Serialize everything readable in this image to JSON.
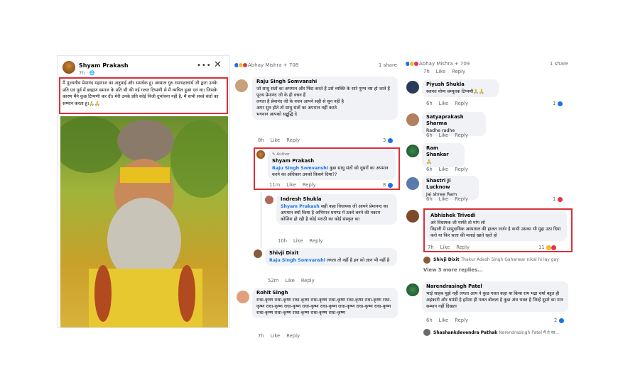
{
  "post": {
    "author": "Shyam Prakash",
    "time": "7h",
    "text": "मैं पूज्यनीय प्रेमानंद महाराज का अनुयाई और समर्थक हूं। अध्याल गुरु रामभद्राचार्य जी द्वारा उनके प्रति एवं पूर्व में ब्राह्मण समाज के प्रति भी की गई गलत टिप्पणी से मैं व्यथित हुआ एवं था। जिसके कारण मैंने कुछ टिप्पणी कर दी। मेरी उनके प्रति कोई निजी दुर्भावना नहीं है, मैं सभी सच्चे संतों का सम्मान करता हूं।🙏🙏",
    "more_icon": "three-dots-icon",
    "close_icon": "close-icon"
  },
  "panel2": {
    "reactors": "Abhay Mishra + 708",
    "shares": "1 share",
    "c1": {
      "name": "Raju Singh Somvanshi",
      "text": "जो साधु संतों का अपमान और निंदा करते हैं उसे व्यक्ति के सारे पुण्य नष्ट हो जाते हैं\nपूज्य प्रेमानंद जी के ही वचन हैं\nलगता है प्रेमानंद जी के वचन आपने सही से सुन नहीं है\nअगर सुन होते तो साधु संतों का अपमान नहीं करते\nभगवान आपको सद्बुद्धि दे",
      "time": "8h",
      "like": "Like",
      "reply": "Reply",
      "count": "3"
    },
    "c2": {
      "author_label": "Author",
      "name": "Shyam Prakash",
      "tag": "Raju Singh Somvanshi",
      "text": " कुछ साधु संतों को दूसरों का अपमान करने का अधिकार उनको किसने दिया??",
      "time": "11m",
      "like": "Like",
      "reply": "Reply",
      "count": "8"
    },
    "c3": {
      "name": "Indresh Shukla",
      "tag": "Shyam Prakash",
      "text": " सही कहा विधायक जी आपने प्रेमानन्द का अपमान क्यों किया है अभिमान घमण्ड में ठकरे बनने की नकाम कोशिश हो रही है कोई मराठी का कोई संस्कृत का",
      "time": "10h",
      "like": "Like",
      "reply": "Reply"
    },
    "c4": {
      "name": "Shivji Dixit",
      "tag": "Raju Singh Somvanshi",
      "text": " लगता तो नहीं है इन को ज्ञान भी नहीं है",
      "time": "52m",
      "like": "Like",
      "reply": "Reply"
    },
    "c5": {
      "name": "Rohit Singh",
      "text": "राधा-कृष्ण राधा-कृष्ण राधा-कृष्ण राधा-कृष्ण राधा-कृष्ण राधा-कृष्ण राधा-कृष्ण राधा-कृष्ण राधा-कृष्ण राधा-कृष्ण राधा-कृष्ण राधा-कृष्ण राधा-कृष्ण राधा-कृष्ण राधा-कृष्ण राधा-कृष्ण राधा-कृष्ण राधा-कृष्ण राधा-कृष्ण राधा-कृष्ण",
      "time": "7h",
      "like": "Like",
      "reply": "Reply"
    }
  },
  "panel3": {
    "reactors": "Abhay Mishra + 709",
    "shares": "1 share",
    "top_actions": {
      "time": "7h",
      "like": "Like",
      "reply": "Reply"
    },
    "c1": {
      "name": "Piyush Shukla",
      "text": "स्वागत योग्य सम्यूतक टिप्पणी🙏🙏",
      "time": "6h",
      "like": "Like",
      "reply": "Reply",
      "count": "1"
    },
    "c2": {
      "name": "Satyaprakash Sharma",
      "text": "Radhe radhe",
      "time": "6h",
      "like": "Like",
      "reply": "Reply"
    },
    "c3": {
      "name": "Ram Shankar",
      "text": "🙏",
      "time": "6h",
      "like": "Like",
      "reply": "Reply"
    },
    "c4": {
      "name": "Shastri Ji Lucknow",
      "text": "Jai shree Ram",
      "time": "6h",
      "like": "Like",
      "reply": "Reply",
      "count": "1"
    },
    "c5": {
      "name": "Abhishek Trivedi",
      "text": "अरे विधायक जी माफी तो मांग लो\nविहानी में सामुदायिक अस्पताल की हालत जर्जर है कभी उसका भी मुद्दा उठा दिया करो या फिर सत्ता की मलाई खाते रहते हो",
      "time": "7h",
      "like": "Like",
      "reply": "Reply",
      "count": "11"
    },
    "c5_reply": {
      "name": "Shivji Dixit",
      "text": " Thakur Adesh Singh Gaharwar nikal hi lay gay"
    },
    "view_more": "View 3 more replies...",
    "c6": {
      "name": "Narendrasingh Patel",
      "text": "भाई साहब मुझे नहीं लगता आप ने कुछ गलत कहा या किया राम भद्रा चर्या बहुत ही अहंकारी और घमंडी है हमेशा ही गलत बोलता है कुछ अंध भक्त है जिन्हें दूसरे का मान सम्मान नहीं दिखता",
      "time": "6h",
      "like": "Like",
      "reply": "Reply",
      "count": "2"
    },
    "c6_reply": {
      "name": "Shashankdevendra Pathak",
      "text": " Narendrasingh Patel मैं ते स्व..."
    }
  },
  "colors": {
    "highlight": "#d9303a",
    "link": "#1b74e4",
    "bubble": "#f0f2f5"
  }
}
